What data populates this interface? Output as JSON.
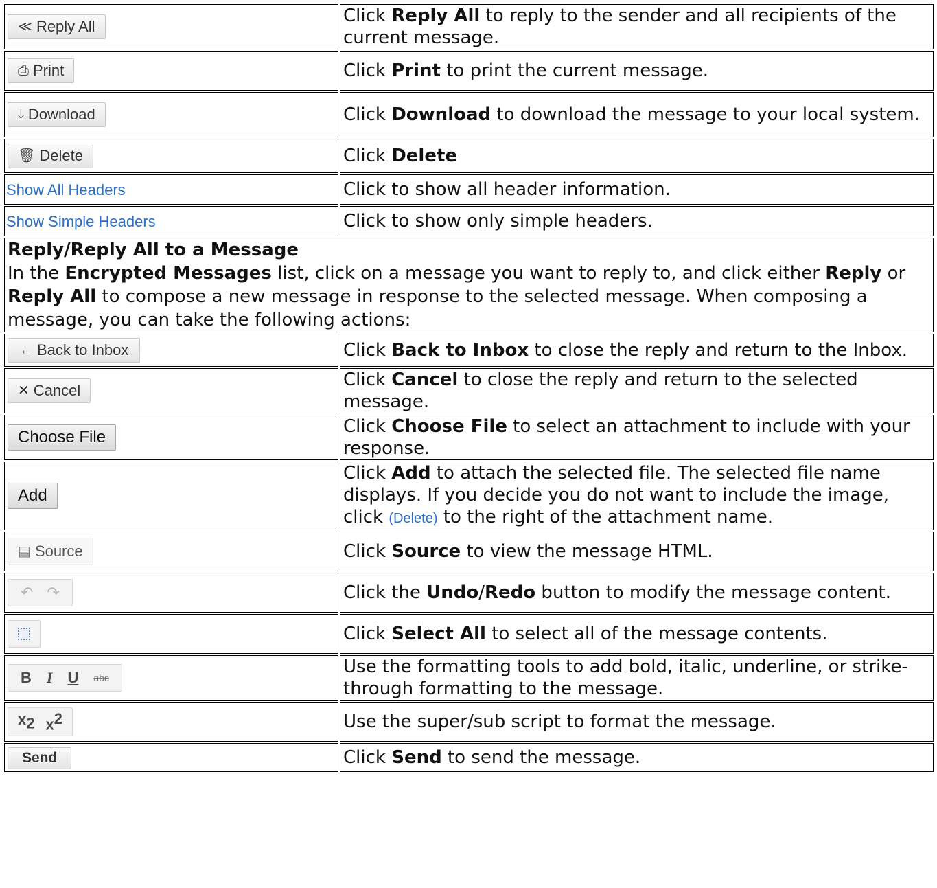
{
  "rows_top": [
    {
      "control": "Reply All",
      "icon": "reply-all-icon",
      "pre": "Click ",
      "term": "Reply All",
      "post": " to reply to the sender and all recipients of the current message."
    },
    {
      "control": "Print",
      "icon": "print-icon",
      "pre": "Click ",
      "term": "Print",
      "post": " to print the current message."
    },
    {
      "control": "Download",
      "icon": "download-icon",
      "pre": "Click ",
      "term": "Download",
      "post": " to download the message to your local system."
    },
    {
      "control": "Delete",
      "icon": "trash-icon",
      "pre": "Click ",
      "term": "Delete",
      "post": ""
    },
    {
      "control": "Show All Headers",
      "text": "Click to show all header information."
    },
    {
      "control": "Show Simple Headers",
      "text": "Click to show only simple headers."
    }
  ],
  "section": {
    "title": "Reply/Reply All to a Message",
    "p1": "In the ",
    "b1": "Encrypted Messages",
    "p2": " list, click on a message you want to reply to, and click either ",
    "b2": "Reply",
    "p3": " or ",
    "b3": "Reply All",
    "p4": " to compose a new message in response to the selected message. When composing a message, you can take the following actions:"
  },
  "rows_bottom": {
    "back": {
      "control": "Back to Inbox",
      "pre": "Click ",
      "term": "Back to Inbox",
      "post": " to close the reply and return to the Inbox."
    },
    "cancel": {
      "control": "Cancel",
      "pre": "Click ",
      "term": "Cancel",
      "post": " to close the reply and return to the selected message."
    },
    "choose": {
      "control": "Choose File",
      "pre": "Click ",
      "term": "Choose File",
      "post": " to select an attachment to include with your response."
    },
    "add": {
      "control": "Add",
      "pre": "Click ",
      "term": "Add",
      "post1": " to attach the selected file. The selected file name displays. If you decide you do not want to include the image, click ",
      "inline": "(Delete)",
      "post2": " to the right of the attachment name."
    },
    "source": {
      "control": "Source",
      "pre": "Click ",
      "term": "Source",
      "post": " to view the message HTML."
    },
    "undo": {
      "pre": "Click the ",
      "term1": "Undo",
      "sep": "/",
      "term2": "Redo",
      "post": " button to modify the message content."
    },
    "selectall": {
      "pre": "Click ",
      "term": "Select All",
      "post": " to select all of the message contents."
    },
    "format": {
      "b": "B",
      "i": "I",
      "u": "U",
      "s": "abc",
      "text": "Use the formatting tools to add bold, italic, underline, or strike-through formatting to the message."
    },
    "script": {
      "x1": "x",
      "sub": "2",
      "x2": "x",
      "sup": "2",
      "text": "Use the super/sub script to format the message."
    },
    "send": {
      "control": "Send",
      "pre": "Click ",
      "term": "Send",
      "post": " to send the message."
    }
  },
  "colors": {
    "link": "#2a6fc9",
    "border": "#000000"
  }
}
